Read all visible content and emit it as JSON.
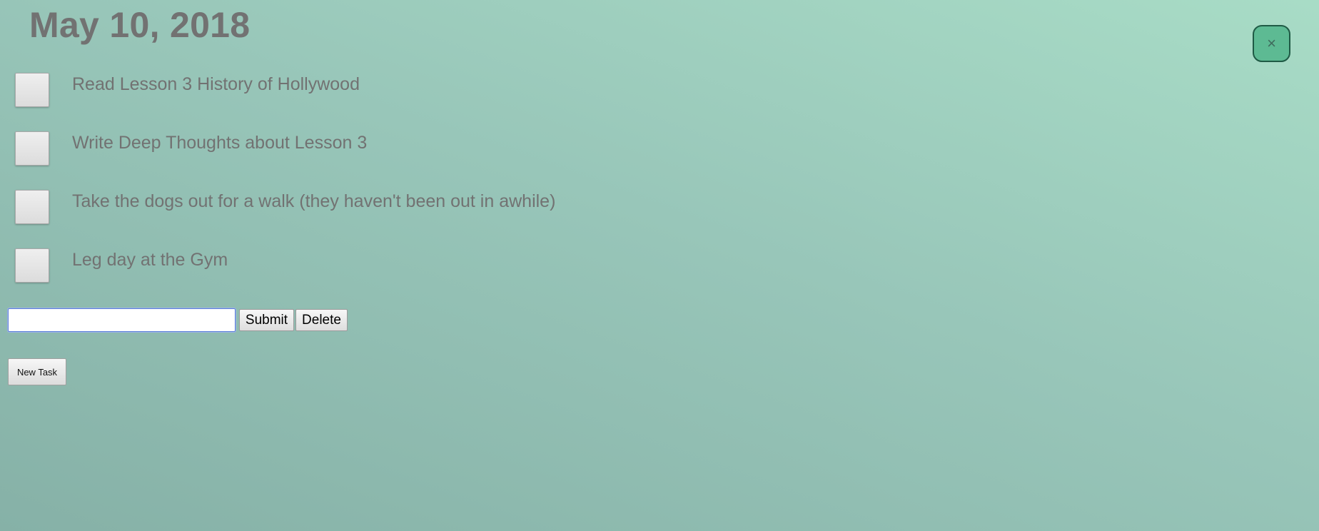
{
  "header": {
    "date": "May 10, 2018",
    "close_symbol": "×"
  },
  "tasks": [
    {
      "label": "Read Lesson 3 History of Hollywood",
      "checked": false
    },
    {
      "label": "Write Deep Thoughts about Lesson 3",
      "checked": false
    },
    {
      "label": "Take the dogs out for a walk (they haven't been out in awhile)",
      "checked": false
    },
    {
      "label": "Leg day at the Gym",
      "checked": false
    }
  ],
  "form": {
    "input_value": "",
    "submit_label": "Submit",
    "delete_label": "Delete",
    "new_task_label": "New Task"
  },
  "colors": {
    "background_top": "#a8dcc6",
    "background_bottom": "#86b1a7",
    "close_button": "#5dba93",
    "close_border": "#1f5a45",
    "text": "#727272"
  },
  "icons": {
    "close": "close-icon"
  }
}
